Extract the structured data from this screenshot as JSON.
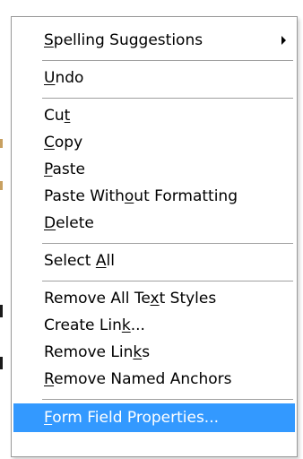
{
  "menu": {
    "items": [
      {
        "id": "spelling-suggestions",
        "pre": "",
        "key": "S",
        "post": "pelling Suggestions",
        "submenu": true
      },
      {
        "id": "undo",
        "pre": "",
        "key": "U",
        "post": "ndo"
      },
      {
        "id": "cut",
        "pre": "Cu",
        "key": "t",
        "post": ""
      },
      {
        "id": "copy",
        "pre": "",
        "key": "C",
        "post": "opy"
      },
      {
        "id": "paste",
        "pre": "",
        "key": "P",
        "post": "aste"
      },
      {
        "id": "paste-without-formatting",
        "pre": "Paste With",
        "key": "o",
        "post": "ut Formatting"
      },
      {
        "id": "delete",
        "pre": "",
        "key": "D",
        "post": "elete"
      },
      {
        "id": "select-all",
        "pre": "Select ",
        "key": "A",
        "post": "ll"
      },
      {
        "id": "remove-all-text-styles",
        "pre": "Remove All Te",
        "key": "x",
        "post": "t Styles"
      },
      {
        "id": "create-link",
        "pre": "Create Lin",
        "key": "k",
        "post": "..."
      },
      {
        "id": "remove-links",
        "pre": "Remove Lin",
        "key": "k",
        "post": "s"
      },
      {
        "id": "remove-named-anchors",
        "pre": "",
        "key": "R",
        "post": "emove Named Anchors"
      },
      {
        "id": "form-field-properties",
        "pre": "",
        "key": "F",
        "post": "orm Field Properties...",
        "highlighted": true
      }
    ]
  },
  "colors": {
    "highlight": "#3399ff",
    "separator": "#a0a0a0"
  }
}
